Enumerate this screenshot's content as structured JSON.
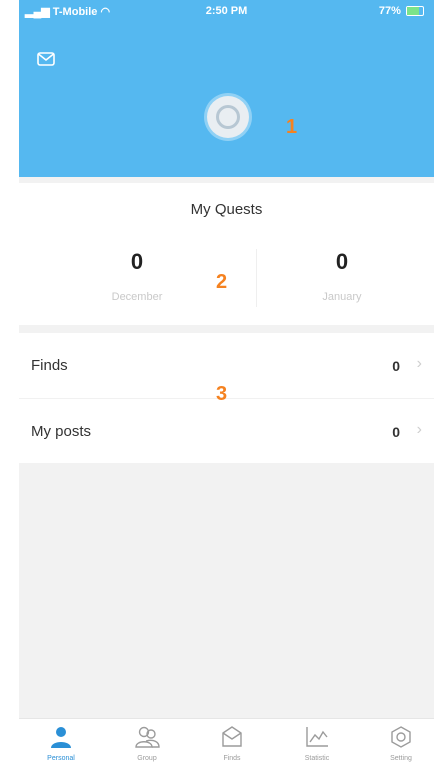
{
  "status_bar": {
    "carrier": "T-Mobile",
    "time": "2:50 PM",
    "battery": "77%"
  },
  "markers": [
    "1",
    "2",
    "3"
  ],
  "quests": {
    "title": "My Quests",
    "columns": [
      {
        "count": "0",
        "month": "December"
      },
      {
        "count": "0",
        "month": "January"
      }
    ]
  },
  "list": {
    "items": [
      {
        "label": "Finds",
        "count": "0"
      },
      {
        "label": "My posts",
        "count": "0"
      }
    ]
  },
  "tabbar": {
    "tabs": [
      {
        "label": "Personal",
        "icon": "person-icon",
        "active": true
      },
      {
        "label": "Group",
        "icon": "group-icon",
        "active": false
      },
      {
        "label": "Finds",
        "icon": "finds-icon",
        "active": false
      },
      {
        "label": "Statistic",
        "icon": "chart-icon",
        "active": false
      },
      {
        "label": "Setting",
        "icon": "setting-icon",
        "active": false
      }
    ]
  },
  "colors": {
    "header": "#55b8f0",
    "accent": "#2a8fd6",
    "marker": "#f58220"
  }
}
